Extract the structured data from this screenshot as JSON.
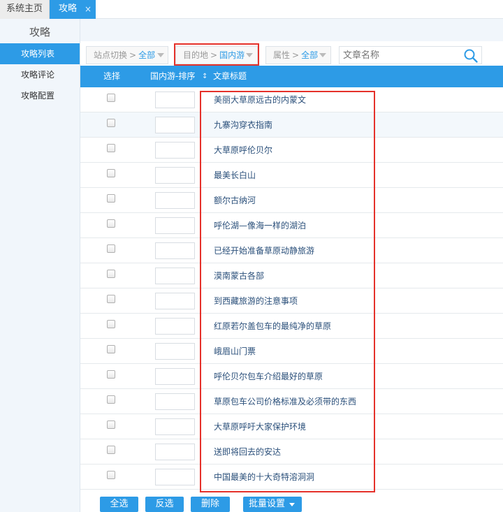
{
  "tabs": {
    "home": "系统主页",
    "active": "攻略",
    "close": "×"
  },
  "sidebar": {
    "title": "攻略",
    "items": [
      {
        "label": "攻略列表"
      },
      {
        "label": "攻略评论"
      },
      {
        "label": "攻略配置"
      }
    ]
  },
  "filters": {
    "site": {
      "label": "站点切换",
      "sep": ">",
      "value": "全部"
    },
    "destination": {
      "label": "目的地",
      "sep": ">",
      "value": "国内游"
    },
    "attribute": {
      "label": "属性",
      "sep": ">",
      "value": "全部"
    },
    "search_placeholder": "文章名称"
  },
  "table": {
    "headers": {
      "select": "选择",
      "sort": "国内游-排序",
      "sort_icon": "↕",
      "title": "文章标题"
    },
    "rows": [
      {
        "title": "美丽大草原远古的内蒙文"
      },
      {
        "title": "九寨沟穿衣指南"
      },
      {
        "title": "大草原呼伦贝尔"
      },
      {
        "title": "最美长白山"
      },
      {
        "title": "额尔古纳河"
      },
      {
        "title": "呼伦湖—像海一样的湖泊"
      },
      {
        "title": "已经开始准备草原动静旅游"
      },
      {
        "title": "漠南蒙古各部"
      },
      {
        "title": "到西藏旅游的注意事项"
      },
      {
        "title": "红原若尔盖包车的最纯净的草原"
      },
      {
        "title": "峨眉山门票"
      },
      {
        "title": "呼伦贝尔包车介绍最好的草原"
      },
      {
        "title": "草原包车公司价格标准及必须带的东西"
      },
      {
        "title": "大草原呼吁大家保护环境"
      },
      {
        "title": "送即将回去的安达"
      },
      {
        "title": "中国最美的十大奇特溶洞洞"
      }
    ]
  },
  "buttons": {
    "select_all": "全选",
    "invert": "反选",
    "delete": "删除",
    "batch": "批量设置"
  },
  "colors": {
    "accent": "#2d9be6",
    "highlight": "#e5312a"
  }
}
